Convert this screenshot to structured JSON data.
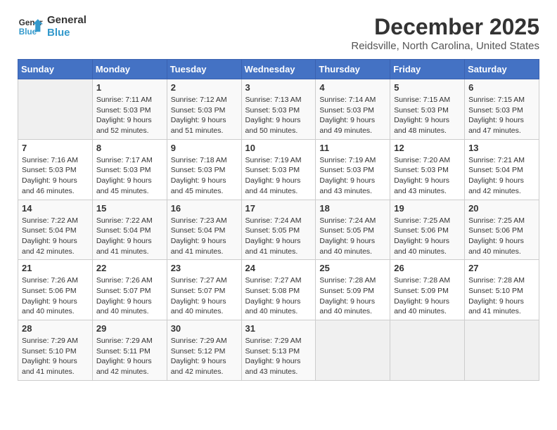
{
  "logo": {
    "line1": "General",
    "line2": "Blue"
  },
  "title": "December 2025",
  "subtitle": "Reidsville, North Carolina, United States",
  "days_of_week": [
    "Sunday",
    "Monday",
    "Tuesday",
    "Wednesday",
    "Thursday",
    "Friday",
    "Saturday"
  ],
  "weeks": [
    [
      {
        "num": "",
        "info": ""
      },
      {
        "num": "1",
        "info": "Sunrise: 7:11 AM\nSunset: 5:03 PM\nDaylight: 9 hours\nand 52 minutes."
      },
      {
        "num": "2",
        "info": "Sunrise: 7:12 AM\nSunset: 5:03 PM\nDaylight: 9 hours\nand 51 minutes."
      },
      {
        "num": "3",
        "info": "Sunrise: 7:13 AM\nSunset: 5:03 PM\nDaylight: 9 hours\nand 50 minutes."
      },
      {
        "num": "4",
        "info": "Sunrise: 7:14 AM\nSunset: 5:03 PM\nDaylight: 9 hours\nand 49 minutes."
      },
      {
        "num": "5",
        "info": "Sunrise: 7:15 AM\nSunset: 5:03 PM\nDaylight: 9 hours\nand 48 minutes."
      },
      {
        "num": "6",
        "info": "Sunrise: 7:15 AM\nSunset: 5:03 PM\nDaylight: 9 hours\nand 47 minutes."
      }
    ],
    [
      {
        "num": "7",
        "info": "Sunrise: 7:16 AM\nSunset: 5:03 PM\nDaylight: 9 hours\nand 46 minutes."
      },
      {
        "num": "8",
        "info": "Sunrise: 7:17 AM\nSunset: 5:03 PM\nDaylight: 9 hours\nand 45 minutes."
      },
      {
        "num": "9",
        "info": "Sunrise: 7:18 AM\nSunset: 5:03 PM\nDaylight: 9 hours\nand 45 minutes."
      },
      {
        "num": "10",
        "info": "Sunrise: 7:19 AM\nSunset: 5:03 PM\nDaylight: 9 hours\nand 44 minutes."
      },
      {
        "num": "11",
        "info": "Sunrise: 7:19 AM\nSunset: 5:03 PM\nDaylight: 9 hours\nand 43 minutes."
      },
      {
        "num": "12",
        "info": "Sunrise: 7:20 AM\nSunset: 5:03 PM\nDaylight: 9 hours\nand 43 minutes."
      },
      {
        "num": "13",
        "info": "Sunrise: 7:21 AM\nSunset: 5:04 PM\nDaylight: 9 hours\nand 42 minutes."
      }
    ],
    [
      {
        "num": "14",
        "info": "Sunrise: 7:22 AM\nSunset: 5:04 PM\nDaylight: 9 hours\nand 42 minutes."
      },
      {
        "num": "15",
        "info": "Sunrise: 7:22 AM\nSunset: 5:04 PM\nDaylight: 9 hours\nand 41 minutes."
      },
      {
        "num": "16",
        "info": "Sunrise: 7:23 AM\nSunset: 5:04 PM\nDaylight: 9 hours\nand 41 minutes."
      },
      {
        "num": "17",
        "info": "Sunrise: 7:24 AM\nSunset: 5:05 PM\nDaylight: 9 hours\nand 41 minutes."
      },
      {
        "num": "18",
        "info": "Sunrise: 7:24 AM\nSunset: 5:05 PM\nDaylight: 9 hours\nand 40 minutes."
      },
      {
        "num": "19",
        "info": "Sunrise: 7:25 AM\nSunset: 5:06 PM\nDaylight: 9 hours\nand 40 minutes."
      },
      {
        "num": "20",
        "info": "Sunrise: 7:25 AM\nSunset: 5:06 PM\nDaylight: 9 hours\nand 40 minutes."
      }
    ],
    [
      {
        "num": "21",
        "info": "Sunrise: 7:26 AM\nSunset: 5:06 PM\nDaylight: 9 hours\nand 40 minutes."
      },
      {
        "num": "22",
        "info": "Sunrise: 7:26 AM\nSunset: 5:07 PM\nDaylight: 9 hours\nand 40 minutes."
      },
      {
        "num": "23",
        "info": "Sunrise: 7:27 AM\nSunset: 5:07 PM\nDaylight: 9 hours\nand 40 minutes."
      },
      {
        "num": "24",
        "info": "Sunrise: 7:27 AM\nSunset: 5:08 PM\nDaylight: 9 hours\nand 40 minutes."
      },
      {
        "num": "25",
        "info": "Sunrise: 7:28 AM\nSunset: 5:09 PM\nDaylight: 9 hours\nand 40 minutes."
      },
      {
        "num": "26",
        "info": "Sunrise: 7:28 AM\nSunset: 5:09 PM\nDaylight: 9 hours\nand 40 minutes."
      },
      {
        "num": "27",
        "info": "Sunrise: 7:28 AM\nSunset: 5:10 PM\nDaylight: 9 hours\nand 41 minutes."
      }
    ],
    [
      {
        "num": "28",
        "info": "Sunrise: 7:29 AM\nSunset: 5:10 PM\nDaylight: 9 hours\nand 41 minutes."
      },
      {
        "num": "29",
        "info": "Sunrise: 7:29 AM\nSunset: 5:11 PM\nDaylight: 9 hours\nand 42 minutes."
      },
      {
        "num": "30",
        "info": "Sunrise: 7:29 AM\nSunset: 5:12 PM\nDaylight: 9 hours\nand 42 minutes."
      },
      {
        "num": "31",
        "info": "Sunrise: 7:29 AM\nSunset: 5:13 PM\nDaylight: 9 hours\nand 43 minutes."
      },
      {
        "num": "",
        "info": ""
      },
      {
        "num": "",
        "info": ""
      },
      {
        "num": "",
        "info": ""
      }
    ]
  ]
}
